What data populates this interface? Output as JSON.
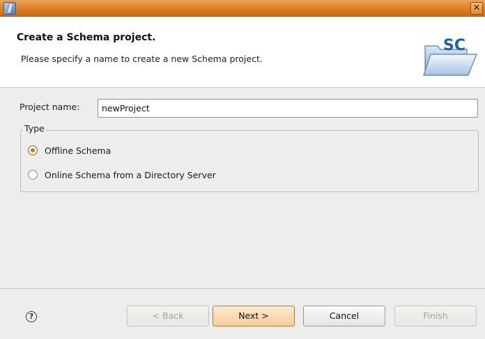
{
  "window": {
    "close_glyph": "✕"
  },
  "header": {
    "title": "Create a Schema project.",
    "description": "Please specify a name to create a new Schema project.",
    "banner_icon_text": "SC"
  },
  "form": {
    "project_name_label": "Project name:",
    "project_name_value": "newProject"
  },
  "type_group": {
    "legend": "Type",
    "options": [
      {
        "label": "Offline Schema",
        "selected": true
      },
      {
        "label": "Online Schema from a Directory Server",
        "selected": false
      }
    ]
  },
  "footer": {
    "help_glyph": "?",
    "back": {
      "label": "< Back",
      "enabled": false
    },
    "next": {
      "label": "Next >",
      "enabled": true
    },
    "cancel": {
      "label": "Cancel",
      "enabled": true
    },
    "finish": {
      "label": "Finish",
      "enabled": false
    }
  },
  "colors": {
    "titlebar": "#d97c1e",
    "radio_selected": "#d9761a",
    "primary_button": "#f6cd9b"
  }
}
